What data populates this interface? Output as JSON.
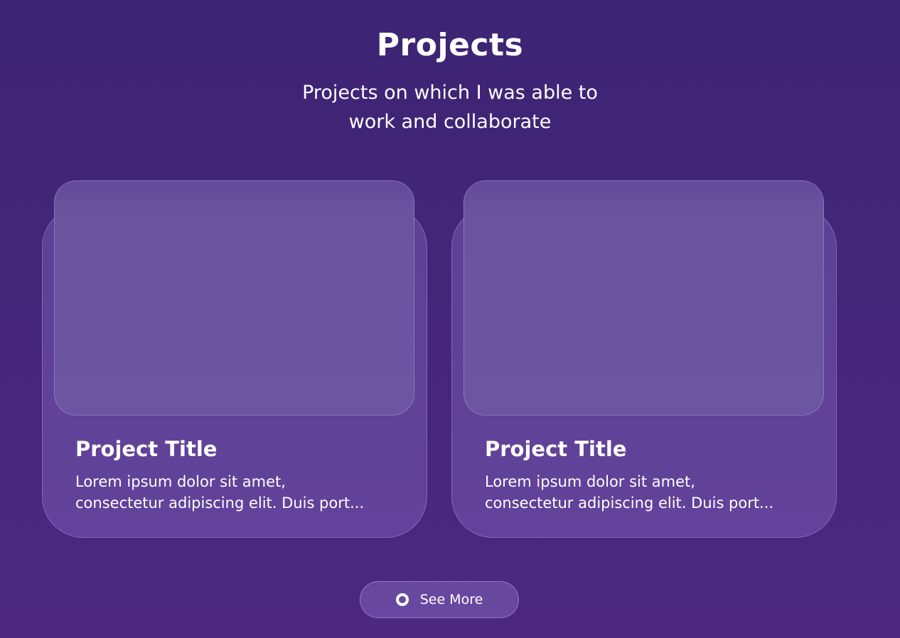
{
  "header": {
    "title": "Projects",
    "subtitle_line1": "Projects on which I was able to",
    "subtitle_line2": "work and collaborate"
  },
  "projects": [
    {
      "title": "Project Title",
      "description_line1": "Lorem ipsum dolor sit amet,",
      "description_line2": "consectetur adipiscing elit. Duis port..."
    },
    {
      "title": "Project Title",
      "description_line1": "Lorem ipsum dolor sit amet,",
      "description_line2": "consectetur adipiscing elit. Duis port..."
    }
  ],
  "actions": {
    "see_more_label": "See More",
    "see_more_icon": "ring-icon"
  },
  "colors": {
    "background_top": "#3d2474",
    "background_bottom": "#4c2880",
    "text": "#ffffff"
  }
}
